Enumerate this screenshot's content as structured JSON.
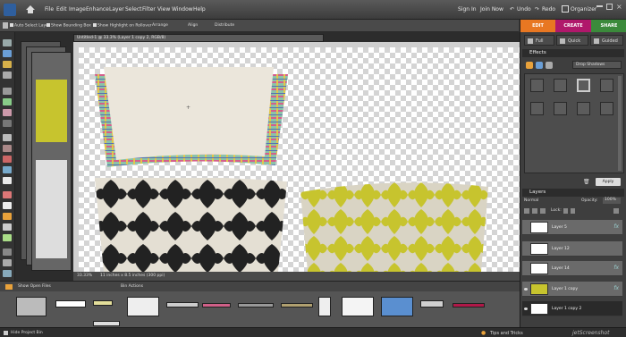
{
  "menubar": {
    "items": [
      "File",
      "Edit",
      "Image",
      "Enhance",
      "Layer",
      "Select",
      "Filter",
      "View",
      "Window",
      "Help"
    ],
    "right": {
      "sign_in": "Sign In",
      "join_now": "Join Now",
      "undo": "Undo",
      "redo": "Redo",
      "organizer": "Organizer"
    }
  },
  "options": {
    "auto_select": "Auto Select Layer",
    "show_bbox": "Show Bounding Box",
    "show_highlight": "Show Highlight on Rollover",
    "arrange": "Arrange",
    "align": "Align",
    "distribute": "Distribute"
  },
  "document": {
    "title": "Untitled-1 @ 33.3% (Layer 1 copy 2, RGB/8)",
    "zoom": "33.33%",
    "size": "11 inches x 8.5 inches (300 ppi)"
  },
  "project_bin": {
    "show_label": "Show Open Files",
    "actions_label": "Bin Actions"
  },
  "bottom": {
    "hide_bin": "Hide Project Bin",
    "tips": "Tips and Tricks",
    "watermark": "jetScreenshot"
  },
  "panel": {
    "tabs": {
      "edit": "EDIT",
      "create": "CREATE",
      "share": "SHARE"
    },
    "modes": {
      "full": "Full",
      "quick": "Quick",
      "guided": "Guided"
    },
    "effects_title": "Effects",
    "effect_dropdown": "Drop Shadows",
    "apply": "Apply",
    "layers_title": "Layers",
    "blend_mode": "Normal",
    "opacity_label": "Opacity:",
    "opacity_value": "100%",
    "lock_label": "Lock:",
    "layers": [
      {
        "name": "Layer 5",
        "fx": "fx"
      },
      {
        "name": "Layer 12",
        "fx": ""
      },
      {
        "name": "Layer 14",
        "fx": "fx"
      },
      {
        "name": "Layer 1 copy",
        "fx": "fx"
      },
      {
        "name": "Layer 1 copy 2",
        "fx": ""
      }
    ]
  },
  "colors": {
    "edit": "#e87722",
    "create": "#b0186b",
    "share": "#3b8a3b",
    "yellow": "#c7c42e"
  }
}
